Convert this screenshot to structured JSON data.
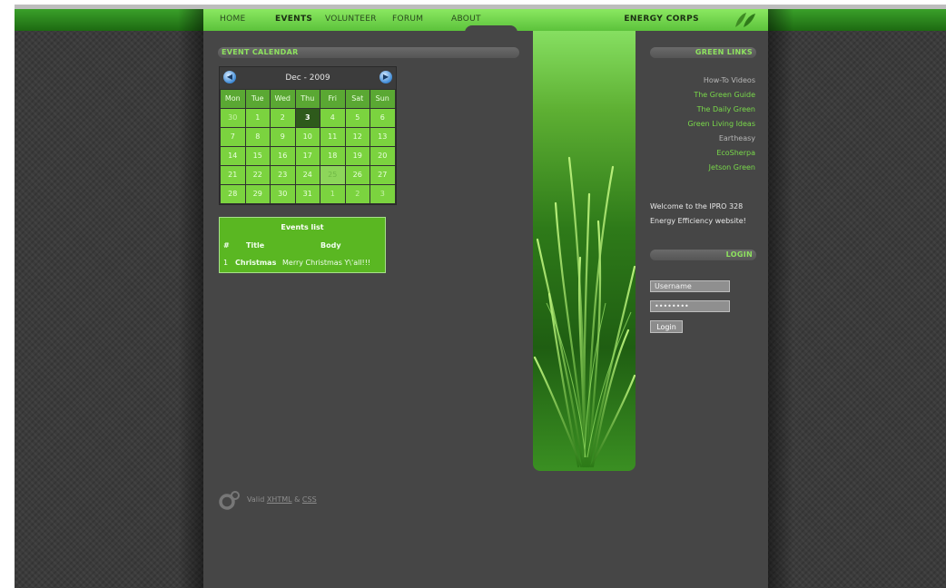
{
  "nav": {
    "items": [
      {
        "label": "HOME"
      },
      {
        "label": "EVENTS",
        "active": true
      },
      {
        "label": "VOLUNTEER"
      },
      {
        "label": "FORUM"
      },
      {
        "label": "ABOUT"
      }
    ],
    "brand": "ENERGY CORPS",
    "logo_icon": "leaves-icon"
  },
  "event_calendar": {
    "heading": "EVENT CALENDAR",
    "month_label": "Dec - 2009",
    "prev_icon": "arrow-left-circle-icon",
    "next_icon": "arrow-right-circle-icon",
    "weekdays": [
      "Mon",
      "Tue",
      "Wed",
      "Thu",
      "Fri",
      "Sat",
      "Sun"
    ],
    "weeks": [
      [
        "30",
        "1",
        "2",
        "3",
        "4",
        "5",
        "6"
      ],
      [
        "7",
        "8",
        "9",
        "10",
        "11",
        "12",
        "13"
      ],
      [
        "14",
        "15",
        "16",
        "17",
        "18",
        "19",
        "20"
      ],
      [
        "21",
        "22",
        "23",
        "24",
        "25",
        "26",
        "27"
      ],
      [
        "28",
        "29",
        "30",
        "31",
        "1",
        "2",
        "3"
      ]
    ],
    "today": "3",
    "event_day": "25"
  },
  "events_list": {
    "title": "Events list",
    "columns": [
      "#",
      "Title",
      "Body"
    ],
    "rows": [
      {
        "num": "1",
        "title": "Christmas",
        "body": "Merry Christmas Y\\'all!!!"
      }
    ]
  },
  "sidebar": {
    "green_links_heading": "GREEN LINKS",
    "links": [
      {
        "label": "How-To Videos",
        "style": "gray"
      },
      {
        "label": "The Green Guide",
        "style": "green"
      },
      {
        "label": "The Daily Green",
        "style": "green"
      },
      {
        "label": "Green Living Ideas",
        "style": "green"
      },
      {
        "label": "Eartheasy",
        "style": "gray"
      },
      {
        "label": "EcoSherpa",
        "style": "green"
      },
      {
        "label": "Jetson Green",
        "style": "green"
      }
    ],
    "welcome": "Welcome to the IPRO 328 Energy Efficiency website!",
    "login_heading": "LOGIN",
    "username_value": "Username",
    "password_value": "••••••••",
    "login_button": "Login"
  },
  "footer": {
    "valid_prefix": "Valid",
    "xhtml": "XHTML",
    "amp": "&",
    "css": "CSS",
    "icon": "link-ring-icon"
  },
  "colors": {
    "accent_green": "#79d94a",
    "nav_green": "#8ae861",
    "panel_dark": "#464646"
  }
}
